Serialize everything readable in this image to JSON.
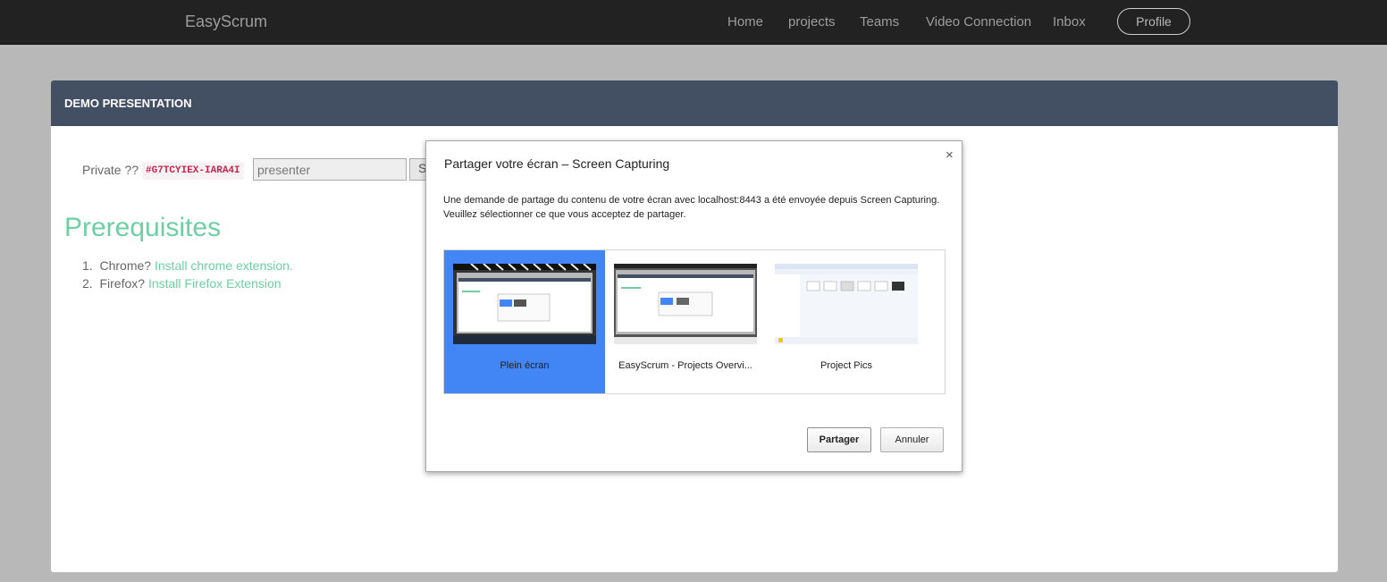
{
  "navbar": {
    "brand": "EasyScrum",
    "items": [
      "Home",
      "projects",
      "Teams",
      "Video Connection",
      "Inbox"
    ],
    "profile": "Profile"
  },
  "panel": {
    "title": "DEMO PRESENTATION",
    "private_label": "Private ??",
    "code": "#G7TCYIEX-IARA4I",
    "presenter_value": "presenter",
    "start_button": "Start",
    "prereq_title": "Prerequisites",
    "prereqs": [
      {
        "num": "1.",
        "text": "Chrome?",
        "link": "Install chrome extension."
      },
      {
        "num": "2.",
        "text": "Firefox?",
        "link": "Install Firefox Extension"
      }
    ]
  },
  "dialog": {
    "title": "Partager votre écran – Screen Capturing",
    "close": "×",
    "description": "Une demande de partage du contenu de votre écran avec localhost:8443 a été envoyée depuis Screen Capturing. Veuillez sélectionner ce que vous acceptez de partager.",
    "sources": [
      {
        "label": "Plein écran",
        "selected": true
      },
      {
        "label": "EasyScrum - Projects Overvi...",
        "selected": false
      },
      {
        "label": "Project Pics",
        "selected": false
      }
    ],
    "share_button": "Partager",
    "cancel_button": "Annuler"
  },
  "colors": {
    "navbar": "#222222",
    "panel_heading": "#435064",
    "accent_green": "#6ecfa5",
    "selection_blue": "#4285f4",
    "code_red": "#c7254e"
  }
}
